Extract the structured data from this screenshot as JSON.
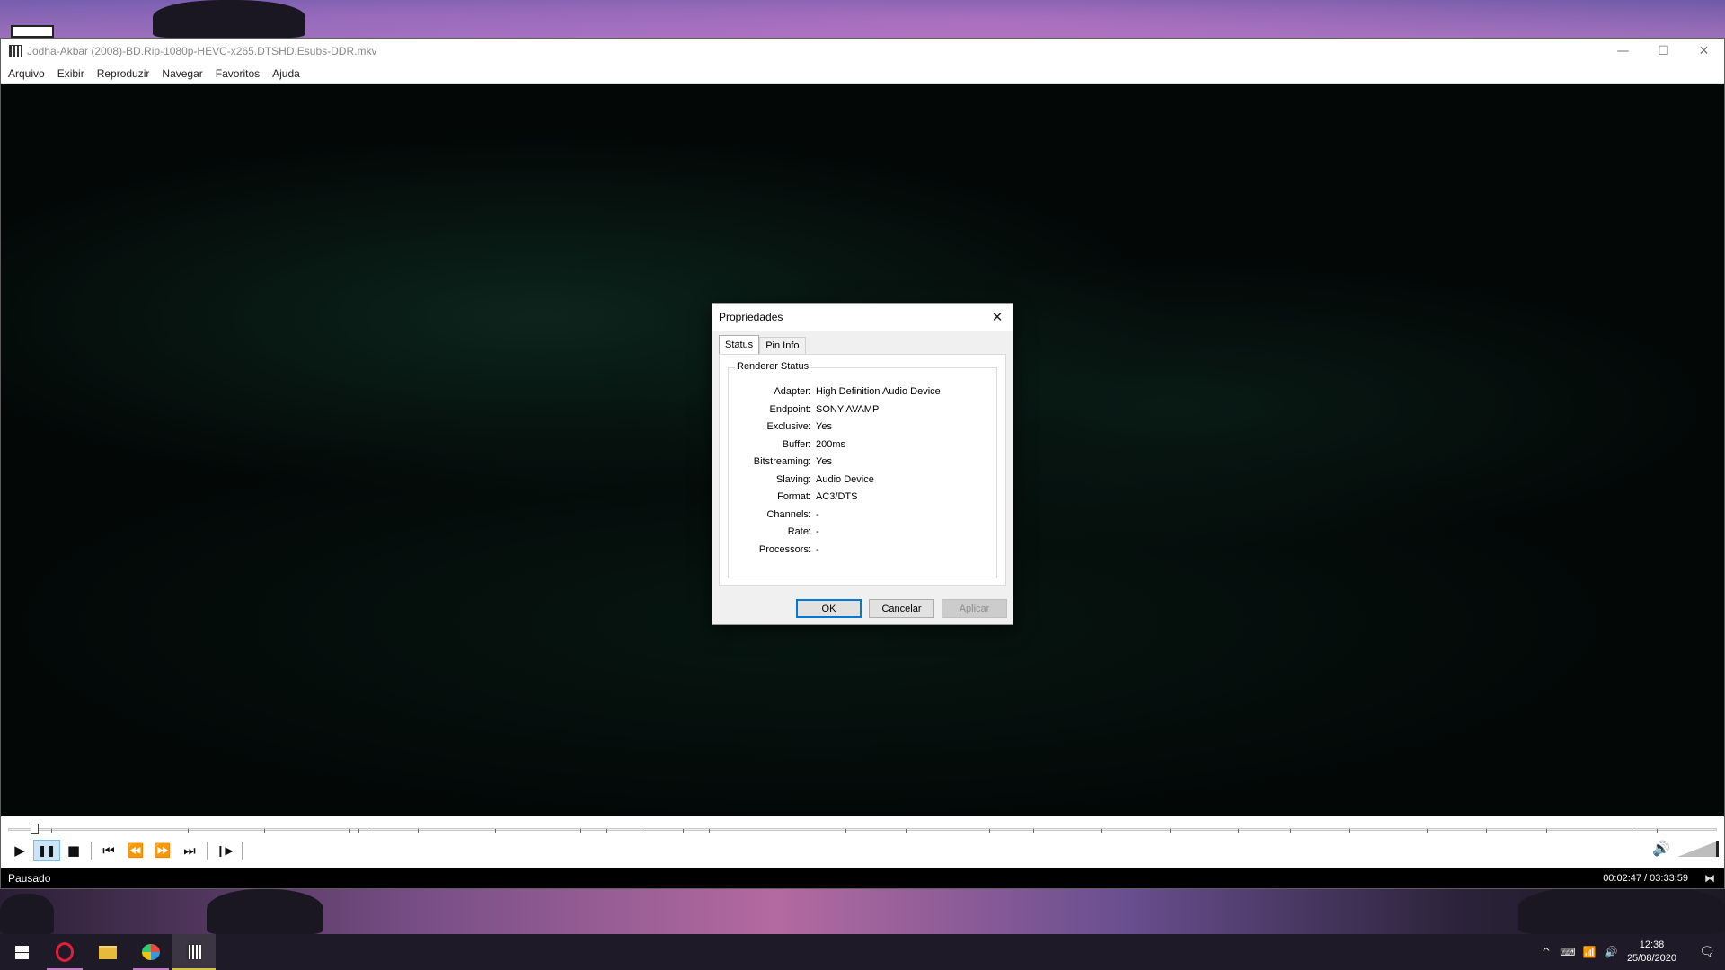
{
  "window": {
    "title": "Jodha-Akbar (2008)-BD.Rip-1080p-HEVC-x265.DTSHD.Esubs-DDR.mkv",
    "controls": {
      "minimize": "—",
      "maximize": "☐",
      "close": "✕"
    }
  },
  "menu": [
    "Arquivo",
    "Exibir",
    "Reproduzir",
    "Navegar",
    "Favoritos",
    "Ajuda"
  ],
  "player": {
    "status": "Pausado",
    "time": "00:02:47 / 03:33:59",
    "progress_fraction": 0.013,
    "volume_fraction": 1.0,
    "buttons": {
      "play": "▶",
      "pause": "❚❚",
      "stop": "■",
      "prev": "⏮",
      "rewind": "⏪",
      "forward": "⏩",
      "next": "⏭",
      "frame_step": "❙▶"
    },
    "volume_icon": "🔊"
  },
  "dialog": {
    "title": "Propriedades",
    "close": "✕",
    "tabs": [
      "Status",
      "Pin Info"
    ],
    "group_title": "Renderer Status",
    "rows": [
      {
        "label": "Adapter:",
        "value": "High Definition Audio Device"
      },
      {
        "label": "Endpoint:",
        "value": "SONY AVAMP"
      },
      {
        "label": "Exclusive:",
        "value": "Yes"
      },
      {
        "label": "Buffer:",
        "value": "200ms"
      },
      {
        "label": "Bitstreaming:",
        "value": "Yes"
      },
      {
        "label": "Slaving:",
        "value": "Audio Device"
      },
      {
        "label": "Format:",
        "value": "AC3/DTS"
      },
      {
        "label": "Channels:",
        "value": "-"
      },
      {
        "label": "Rate:",
        "value": "-"
      },
      {
        "label": "Processors:",
        "value": "-"
      }
    ],
    "buttons": {
      "ok": "OK",
      "cancel": "Cancelar",
      "apply": "Aplicar"
    }
  },
  "taskbar": {
    "clock_time": "12:38",
    "clock_date": "25/08/2020",
    "tray": {
      "chevron": "^",
      "keyboard": "⌨",
      "network": "📶",
      "volume": "🔊",
      "notifications": "🗨"
    }
  },
  "colors": {
    "accent": "#0078d7",
    "taskbar": "#1f1a27",
    "active_indicator": "#d8c246"
  }
}
